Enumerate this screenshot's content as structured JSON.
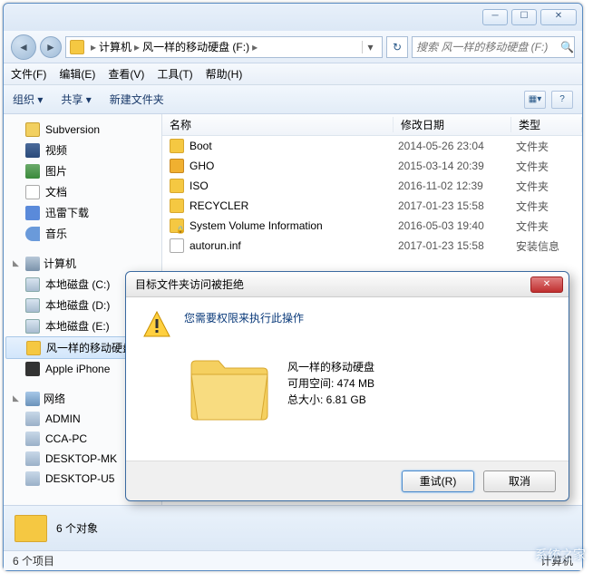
{
  "titlebar": {
    "min": "─",
    "max": "☐",
    "close": "✕"
  },
  "nav": {
    "back": "◄",
    "fwd": "►",
    "path": {
      "seg1": "计算机",
      "seg2": "风一样的移动硬盘 (F:)"
    },
    "sep": "▸",
    "drop": "▾",
    "refresh": "↻",
    "search_placeholder": "搜索 风一样的移动硬盘 (F:)",
    "search_ico": "🔍"
  },
  "menu": {
    "file": "文件(F)",
    "edit": "编辑(E)",
    "view": "查看(V)",
    "tools": "工具(T)",
    "help": "帮助(H)"
  },
  "toolbar": {
    "org": "组织 ▾",
    "share": "共享 ▾",
    "newf": "新建文件夹",
    "view_ico": "▦▾",
    "help_ico": "?"
  },
  "sidebar": {
    "items": [
      {
        "ico": "fav",
        "label": "Subversion"
      },
      {
        "ico": "vid",
        "label": "视频"
      },
      {
        "ico": "img",
        "label": "图片"
      },
      {
        "ico": "doc",
        "label": "文档"
      },
      {
        "ico": "dl",
        "label": "迅雷下载"
      },
      {
        "ico": "mus",
        "label": "音乐"
      }
    ],
    "computer": {
      "tri": "◣",
      "label": "计算机",
      "items": [
        {
          "ico": "drive",
          "label": "本地磁盘 (C:)"
        },
        {
          "ico": "drive",
          "label": "本地磁盘 (D:)"
        },
        {
          "ico": "drive",
          "label": "本地磁盘 (E:)"
        },
        {
          "ico": "usb",
          "label": "风一样的移动硬盘",
          "selected": true
        },
        {
          "ico": "phone",
          "label": "Apple iPhone"
        }
      ]
    },
    "network": {
      "tri": "◣",
      "label": "网络",
      "items": [
        {
          "ico": "pc",
          "label": "ADMIN"
        },
        {
          "ico": "pc",
          "label": "CCA-PC"
        },
        {
          "ico": "pc",
          "label": "DESKTOP-MK"
        },
        {
          "ico": "pc",
          "label": "DESKTOP-U5"
        }
      ]
    }
  },
  "columns": {
    "name": "名称",
    "date": "修改日期",
    "type": "类型"
  },
  "files": [
    {
      "ico": "folder",
      "name": "Boot",
      "date": "2014-05-26 23:04",
      "type": "文件夹"
    },
    {
      "ico": "gho",
      "name": "GHO",
      "date": "2015-03-14 20:39",
      "type": "文件夹"
    },
    {
      "ico": "folder",
      "name": "ISO",
      "date": "2016-11-02 12:39",
      "type": "文件夹"
    },
    {
      "ico": "folder",
      "name": "RECYCLER",
      "date": "2017-01-23 15:58",
      "type": "文件夹"
    },
    {
      "ico": "lock",
      "name": "System Volume Information",
      "date": "2016-05-03 19:40",
      "type": "文件夹"
    },
    {
      "ico": "file",
      "name": "autorun.inf",
      "date": "2017-01-23 15:58",
      "type": "安装信息"
    }
  ],
  "detail": {
    "text": "6 个对象"
  },
  "status": {
    "left": "6 个项目",
    "right": "计算机"
  },
  "dialog": {
    "title": "目标文件夹访问被拒绝",
    "message": "您需要权限来执行此操作",
    "drive_name": "风一样的移动硬盘",
    "free_label": "可用空间: ",
    "free_val": "474 MB",
    "total_label": "总大小: ",
    "total_val": "6.81 GB",
    "retry": "重试(R)",
    "cancel": "取消",
    "close": "✕"
  },
  "watermark": "系统之家"
}
